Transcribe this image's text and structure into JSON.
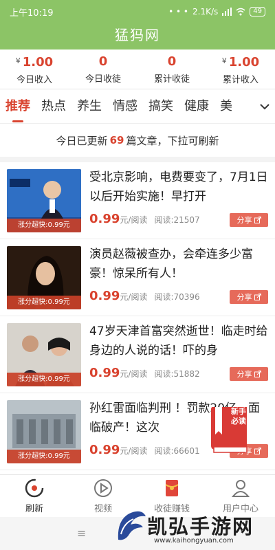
{
  "status_bar": {
    "time": "上午10:19",
    "network_speed": "2.1K/s",
    "battery": "49"
  },
  "app": {
    "title": "猛犸网"
  },
  "stats": [
    {
      "value": "1.00",
      "currency": "¥",
      "label": "今日收入"
    },
    {
      "value": "0",
      "currency": "",
      "label": "今日收徒"
    },
    {
      "value": "0",
      "currency": "",
      "label": "累计收徒"
    },
    {
      "value": "1.00",
      "currency": "¥",
      "label": "累计收入"
    }
  ],
  "tabs": [
    {
      "label": "推荐",
      "active": true
    },
    {
      "label": "热点",
      "active": false
    },
    {
      "label": "养生",
      "active": false
    },
    {
      "label": "情感",
      "active": false
    },
    {
      "label": "搞笑",
      "active": false
    },
    {
      "label": "健康",
      "active": false
    },
    {
      "label": "美",
      "active": false
    }
  ],
  "notice": {
    "before": "今日已更新",
    "count": "69",
    "after": "篇文章，下拉可刷新"
  },
  "article_common": {
    "badge": "涨分超快:0.99元",
    "price": "0.99",
    "price_unit": "元/阅读",
    "share": "分享"
  },
  "articles": [
    {
      "title": "受北京影响，电费要变了，7月1日以后开始实施！早打开",
      "reads": "阅读:21507"
    },
    {
      "title": "演员赵薇被查办，会牵连多少富豪！惊呆所有人！",
      "reads": "阅读:70396"
    },
    {
      "title": "47岁天津首富突然逝世！临走时给身边的人说的话！吓的身",
      "reads": "阅读:51882"
    },
    {
      "title": "孙红雷面临判刑 ！罚款20亿，面临破产！这次",
      "reads": "阅读:66601"
    }
  ],
  "floating_badge": {
    "text": "新手必读"
  },
  "bottom_nav": [
    {
      "label": "刷新",
      "icon": "refresh-icon",
      "active": true
    },
    {
      "label": "视频",
      "icon": "play-icon",
      "active": false
    },
    {
      "label": "收徒赚钱",
      "icon": "red-envelope-icon",
      "active": false
    },
    {
      "label": "用户中心",
      "icon": "user-icon",
      "active": false
    }
  ],
  "watermark": {
    "brand": "凯弘手游网",
    "url": "www.kaihongyuan.com"
  },
  "colors": {
    "header_green": "#8cc466",
    "accent_red": "#d9432f"
  }
}
